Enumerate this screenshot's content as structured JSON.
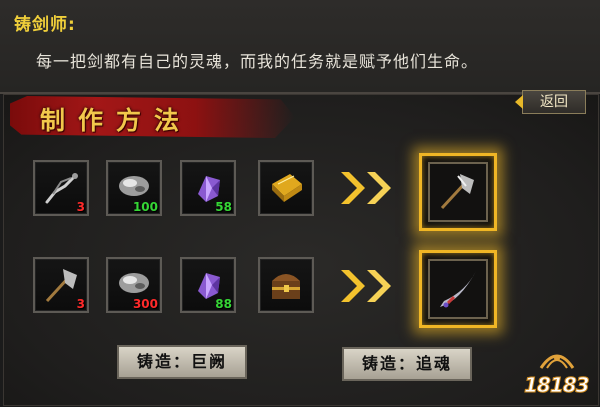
{
  "dialog": {
    "npc_name": "铸剑师:",
    "npc_line": "每一把剑都有自己的灵魂，而我的任务就是赋予他们生命。"
  },
  "panel": {
    "title": "制作方法",
    "back_label": "返回"
  },
  "recipes": [
    {
      "materials": [
        {
          "icon": "whip-weapon-icon",
          "count": "3",
          "count_color": "red"
        },
        {
          "icon": "silver-ore-icon",
          "count": "100",
          "count_color": "green"
        },
        {
          "icon": "purple-crystal-icon",
          "count": "58",
          "count_color": "green"
        },
        {
          "icon": "gold-scroll-icon",
          "count": "",
          "count_color": "none"
        }
      ],
      "result_icon": "battle-axe-icon",
      "forge_label": "铸造：巨阙"
    },
    {
      "materials": [
        {
          "icon": "battle-axe-icon",
          "count": "3",
          "count_color": "red"
        },
        {
          "icon": "silver-ore-icon",
          "count": "300",
          "count_color": "red"
        },
        {
          "icon": "purple-crystal-icon",
          "count": "88",
          "count_color": "green"
        },
        {
          "icon": "treasure-chest-icon",
          "count": "",
          "count_color": "none"
        }
      ],
      "result_icon": "curved-blade-icon",
      "forge_label": "铸造：追魂"
    }
  ],
  "watermark": {
    "text": "18183"
  },
  "colors": {
    "name_gold": "#f0cf3a",
    "banner_red": "#a31717",
    "glow_gold": "#f0b625",
    "count_red": "#ff2a2a",
    "count_green": "#35d635"
  }
}
